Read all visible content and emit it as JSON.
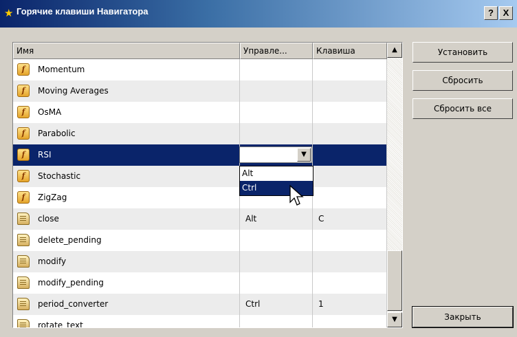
{
  "window": {
    "title": "Горячие клавиши Навигатора",
    "help_label": "?",
    "close_label": "X"
  },
  "table": {
    "columns": [
      "Имя",
      "Управле...",
      "Клавиша"
    ],
    "rows": [
      {
        "name": "Momentum",
        "icon": "indicator",
        "control": "",
        "key": ""
      },
      {
        "name": "Moving Averages",
        "icon": "indicator",
        "control": "",
        "key": ""
      },
      {
        "name": "OsMA",
        "icon": "indicator",
        "control": "",
        "key": ""
      },
      {
        "name": "Parabolic",
        "icon": "indicator",
        "control": "",
        "key": ""
      },
      {
        "name": "RSI",
        "icon": "indicator",
        "control": "",
        "key": "",
        "selected": true
      },
      {
        "name": "Stochastic",
        "icon": "indicator",
        "control": "",
        "key": ""
      },
      {
        "name": "ZigZag",
        "icon": "indicator",
        "control": "",
        "key": ""
      },
      {
        "name": "close",
        "icon": "script",
        "control": "Alt",
        "key": "C"
      },
      {
        "name": "delete_pending",
        "icon": "script",
        "control": "",
        "key": ""
      },
      {
        "name": "modify",
        "icon": "script",
        "control": "",
        "key": ""
      },
      {
        "name": "modify_pending",
        "icon": "script",
        "control": "",
        "key": ""
      },
      {
        "name": "period_converter",
        "icon": "script",
        "control": "Ctrl",
        "key": "1"
      },
      {
        "name": "rotate_text",
        "icon": "script",
        "control": "",
        "key": ""
      }
    ]
  },
  "combo": {
    "value": "",
    "options": [
      "Alt",
      "Ctrl"
    ],
    "highlighted": "Ctrl"
  },
  "buttons": {
    "set": "Установить",
    "reset": "Сбросить",
    "reset_all": "Сбросить все",
    "close": "Закрыть"
  },
  "icons": {
    "title": "star-icon",
    "indicator": "function-icon",
    "script": "script-icon"
  },
  "colors": {
    "title_bar": "#0a246a",
    "selection": "#0a246a",
    "dialog_bg": "#d4d0c8"
  }
}
